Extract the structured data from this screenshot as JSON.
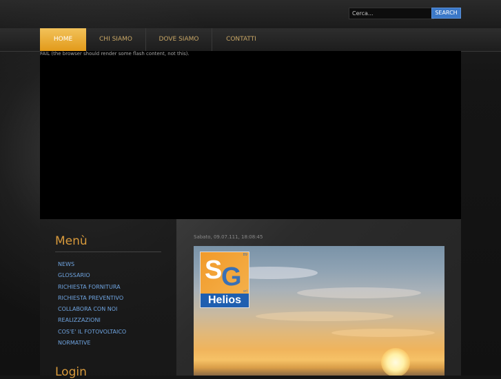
{
  "search": {
    "placeholder": "Cerca...",
    "button_label": "SEARCH"
  },
  "nav": {
    "items": [
      {
        "label": "HOME",
        "active": true
      },
      {
        "label": "CHI SIAMO",
        "active": false
      },
      {
        "label": "DOVE SIAMO",
        "active": false
      },
      {
        "label": "CONTATTI",
        "active": false
      }
    ]
  },
  "flash": {
    "message": "FAIL (the browser should render some flash content, not this)."
  },
  "sidebar": {
    "menu_title": "Menù",
    "items": [
      "NEWS",
      "GLOSSARIO",
      "RICHIESTA FORNITURA",
      "RICHIESTA PREVENTIVO",
      "COLLABORA CON NOI",
      "REALIZZAZIONI",
      "COS'E' IL FOTOVOLTAICO",
      "NORMATIVE"
    ],
    "login_title": "Login"
  },
  "main": {
    "date": "Sabato, 09.07.111, 18:08:45",
    "logo": {
      "brand": "Helios",
      "letters_top": "S",
      "letters_bottom": "G",
      "tag_top": "89",
      "tag_bottom": "srl"
    }
  },
  "colors": {
    "accent_orange": "#e29a1a",
    "link_blue": "#6fa4e0",
    "heading_gold": "#d89a3c",
    "search_button": "#3b78c8"
  }
}
